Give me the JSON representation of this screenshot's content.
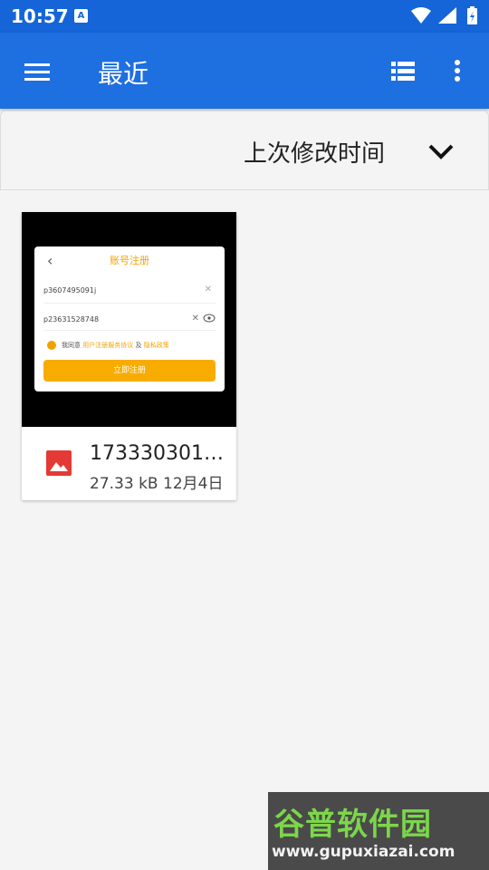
{
  "status": {
    "time": "10:57",
    "notification_badge": "A"
  },
  "appbar": {
    "title": "最近"
  },
  "sort": {
    "label": "上次修改时间"
  },
  "file": {
    "name": "173330301…",
    "size": "27.33 kB",
    "date": "12月4日",
    "thumbnail": {
      "title": "账号注册",
      "username": "p3607495091j",
      "password": "p23631528748",
      "agree_prefix": "我同意",
      "agree_link1": "用户注册服务协议",
      "agree_and": "及",
      "agree_link2": "隐私政策",
      "button": "立即注册"
    }
  },
  "watermark": {
    "name": "谷普软件园",
    "url": "www.gupuxiazai.com"
  },
  "colors": {
    "appbar": "#1e6fe0",
    "accent": "#f8ac00",
    "file_icon": "#e53935",
    "watermark_green": "#7cd64a"
  }
}
